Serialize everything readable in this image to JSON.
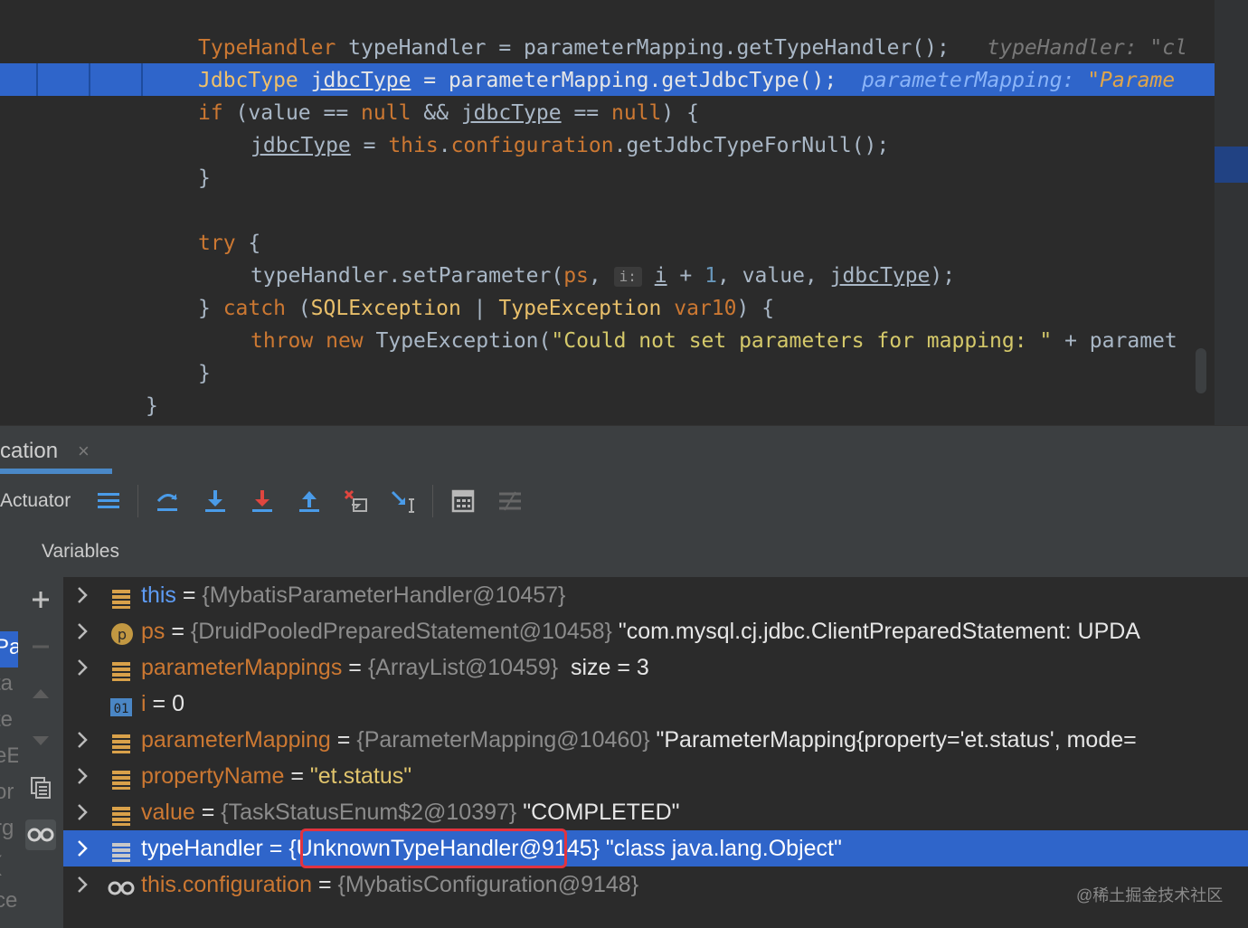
{
  "editor": {
    "lines": {
      "l1": {
        "type": "TypeHandler",
        "rest": " typeHandler = parameterMapping.getTypeHandler();",
        "hint": "typeHandler: \"cl"
      },
      "l2": {
        "type": "JdbcType",
        "var": "jdbcType",
        "rest": " = parameterMapping.getJdbcType();",
        "hint": "parameterMapping: ",
        "hint_str": "\"Parame"
      },
      "l3": {
        "kw": "if",
        "a": " (value == ",
        "null1": "null",
        "b": " && ",
        "var": "jdbcType",
        "c": " == ",
        "null2": "null",
        "d": ") {"
      },
      "l4": {
        "var": "jdbcType",
        "a": " = ",
        "kw": "this",
        "b": ".",
        "fld": "configuration",
        "c": ".getJdbcTypeForNull();"
      },
      "l5": {
        "text": "}"
      },
      "l6": {
        "kw": "try",
        "rest": " {"
      },
      "l7": {
        "a": "typeHandler.setParameter(",
        "ps": "ps",
        "b": ", ",
        "hint": "i:",
        "i": "i",
        "c": " + ",
        "num": "1",
        "d": ", value, ",
        "var": "jdbcType",
        "e": ");"
      },
      "l8": {
        "a": "} ",
        "kw": "catch",
        "b": " (",
        "t1": "SQLException",
        "c": " | ",
        "t2": "TypeException",
        "d": " ",
        "v": "var10",
        "e": ") {"
      },
      "l9": {
        "kw1": "throw",
        "kw2": "new",
        "a": " TypeException(",
        "str": "\"Could not set parameters for mapping: \"",
        "b": " + paramet"
      },
      "l10": {
        "text": "}"
      },
      "l11": {
        "text": "}"
      }
    }
  },
  "debug": {
    "tab_label": "cation",
    "tab_close": "×",
    "thread_label": "Actuator",
    "variables_title": "Variables",
    "left_fragments": [
      "Pa",
      "ta",
      "te",
      "eE",
      "or",
      "rg",
      "(",
      "ce"
    ]
  },
  "variables": [
    {
      "name": "this",
      "eq": " = ",
      "obj": "{MybatisParameterHandler@10457}",
      "value": "",
      "icon": "field-icon",
      "expandable": true
    },
    {
      "name": "ps",
      "eq": " = ",
      "obj": "{DruidPooledPreparedStatement@10458}",
      "value": " \"com.mysql.cj.jdbc.ClientPreparedStatement: UPDA",
      "icon": "parameter-icon",
      "expandable": true
    },
    {
      "name": "parameterMappings",
      "eq": " = ",
      "obj": "{ArrayList@10459}",
      "value": "  size = 3",
      "icon": "field-icon",
      "expandable": true
    },
    {
      "name": "i",
      "eq": " = ",
      "obj": "",
      "value": "0",
      "icon": "primitive-icon",
      "expandable": false
    },
    {
      "name": "parameterMapping",
      "eq": " = ",
      "obj": "{ParameterMapping@10460}",
      "value": " \"ParameterMapping{property='et.status', mode=",
      "icon": "field-icon",
      "expandable": true
    },
    {
      "name": "propertyName",
      "eq": " = ",
      "obj": "",
      "value": "\"et.status\"",
      "icon": "field-icon",
      "expandable": true
    },
    {
      "name": "value",
      "eq": " = ",
      "obj": "{TaskStatusEnum$2@10397}",
      "value": " \"COMPLETED\"",
      "icon": "field-icon",
      "expandable": true
    },
    {
      "name": "typeHandler",
      "eq": " = ",
      "obj": "{UnknownTypeHandler@9145}",
      "value": " \"class java.lang.Object\"",
      "icon": "field-icon",
      "expandable": true,
      "selected": true
    },
    {
      "name": "this.configuration",
      "eq": " = ",
      "obj": "{MybatisConfiguration@9148}",
      "value": "",
      "icon": "watch-icon",
      "expandable": true
    }
  ],
  "watermark": "@稀土掘金技术社区",
  "colors": {
    "selection": "#2f65ca",
    "keyword": "#cc7832",
    "string": "#6a8759",
    "highlight_box": "#e2333e"
  }
}
